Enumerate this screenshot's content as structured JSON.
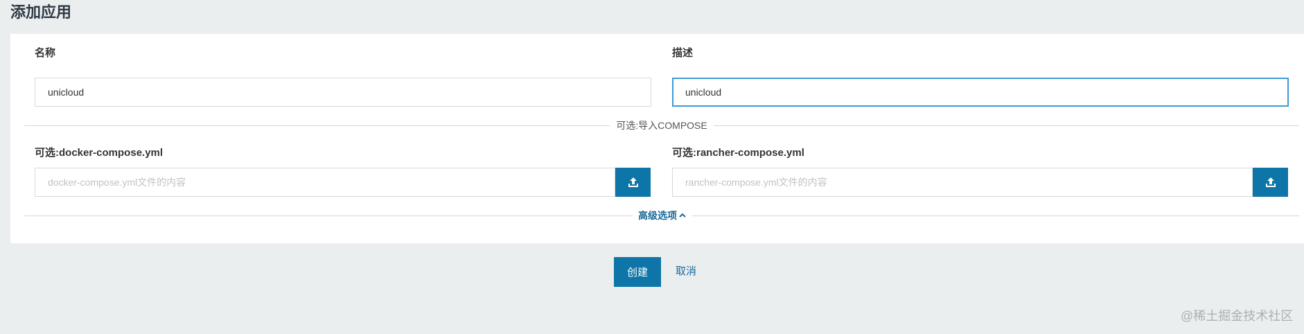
{
  "page": {
    "title": "添加应用"
  },
  "form": {
    "name_label": "名称",
    "name_value": "unicloud",
    "description_label": "描述",
    "description_value": "unicloud",
    "import_divider_label": "可选:导入COMPOSE",
    "docker_compose_label": "可选:docker-compose.yml",
    "docker_compose_placeholder": "docker-compose.yml文件的内容",
    "rancher_compose_label": "可选:rancher-compose.yml",
    "rancher_compose_placeholder": "rancher-compose.yml文件的内容",
    "advanced_options_label": "高级选项",
    "advanced_options_icon": "chevron-up-icon",
    "upload_icon": "upload-icon"
  },
  "actions": {
    "create_label": "创建",
    "cancel_label": "取消"
  },
  "watermark": "@稀土掘金技术社区",
  "colors": {
    "primary": "#0d75a7",
    "focus_border": "#3b9bd6",
    "background": "#ebeeef"
  }
}
